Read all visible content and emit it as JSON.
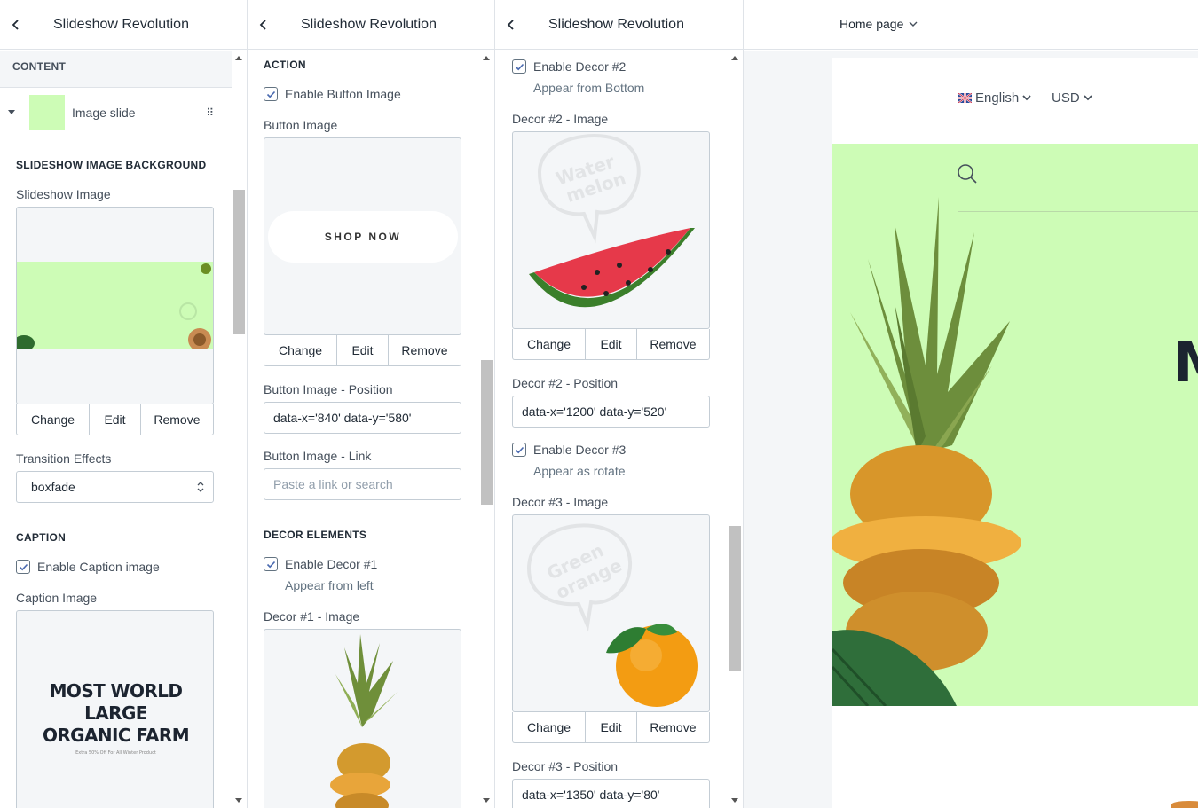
{
  "panel1": {
    "title": "Slideshow Revolution",
    "content_heading": "CONTENT",
    "block_label": "Image slide",
    "bg_heading": "SLIDESHOW IMAGE BACKGROUND",
    "slideshow_image_label": "Slideshow Image",
    "change": "Change",
    "edit": "Edit",
    "remove": "Remove",
    "transition_label": "Transition Effects",
    "transition_value": "boxfade",
    "caption_heading": "CAPTION",
    "enable_caption": "Enable Caption image",
    "caption_image_label": "Caption Image",
    "caption_text_line1": "MOST WORLD LARGE",
    "caption_text_line2": "ORGANIC FARM",
    "caption_small": "Extra 50% Off For All Winter Product"
  },
  "panel2": {
    "title": "Slideshow Revolution",
    "action_heading": "ACTION",
    "enable_button_image": "Enable Button Image",
    "button_image_label": "Button Image",
    "shop_now": "SHOP NOW",
    "change": "Change",
    "edit": "Edit",
    "remove": "Remove",
    "button_position_label": "Button Image - Position",
    "button_position_value": "data-x='840' data-y='580'",
    "button_link_label": "Button Image - Link",
    "button_link_placeholder": "Paste a link or search",
    "decor_heading": "DECOR ELEMENTS",
    "enable_decor1": "Enable Decor #1",
    "decor1_hint": "Appear from left",
    "decor1_image_label": "Decor #1 - Image"
  },
  "panel3": {
    "title": "Slideshow Revolution",
    "enable_decor2": "Enable Decor #2",
    "decor2_hint": "Appear from Bottom",
    "decor2_image_label": "Decor #2 - Image",
    "decor2_bubble": "Water melon",
    "change": "Change",
    "edit": "Edit",
    "remove": "Remove",
    "decor2_position_label": "Decor #2 - Position",
    "decor2_position_value": "data-x='1200' data-y='520'",
    "enable_decor3": "Enable Decor #3",
    "decor3_hint": "Appear as rotate",
    "decor3_image_label": "Decor #3 - Image",
    "decor3_bubble": "Green orange",
    "decor3_position_label": "Decor #3 - Position",
    "decor3_position_value": "data-x='1350' data-y='80'"
  },
  "preview": {
    "page_select": "Home page",
    "language": "English",
    "currency": "USD",
    "hero_partial_letter": "M"
  },
  "colors": {
    "hero_bg": "#cdfcb6",
    "border": "#c4cdd5",
    "text": "#212b36"
  }
}
